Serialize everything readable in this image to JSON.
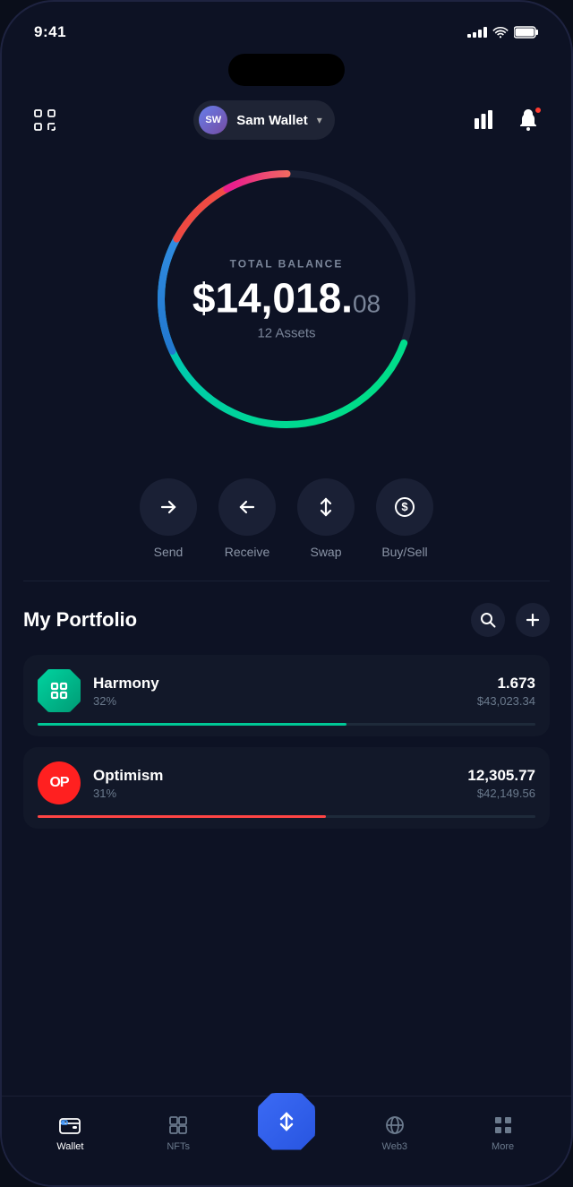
{
  "statusBar": {
    "time": "9:41",
    "signalBars": [
      3,
      5,
      7,
      9,
      11
    ],
    "wifi": true,
    "battery": 100
  },
  "header": {
    "avatarInitials": "SW",
    "walletName": "Sam Wallet",
    "chevron": "▾",
    "scanIconLabel": "scan",
    "chartIconLabel": "chart",
    "notificationIconLabel": "notification"
  },
  "balance": {
    "label": "TOTAL BALANCE",
    "whole": "$14,018.",
    "cents": "08",
    "assets": "12 Assets"
  },
  "actions": [
    {
      "id": "send",
      "label": "Send",
      "icon": "→"
    },
    {
      "id": "receive",
      "label": "Receive",
      "icon": "←"
    },
    {
      "id": "swap",
      "label": "Swap",
      "icon": "⇅"
    },
    {
      "id": "buysell",
      "label": "Buy/Sell",
      "icon": "💲"
    }
  ],
  "portfolio": {
    "title": "My Portfolio",
    "searchLabel": "search",
    "addLabel": "add",
    "assets": [
      {
        "id": "harmony",
        "name": "Harmony",
        "pct": "32%",
        "amount": "1.673",
        "value": "$43,023.34",
        "barWidth": "62",
        "barColor": "#00c896",
        "iconColor1": "#00d4a0",
        "iconColor2": "#009b75",
        "iconType": "harmony",
        "iconText": "⊞"
      },
      {
        "id": "optimism",
        "name": "Optimism",
        "pct": "31%",
        "amount": "12,305.77",
        "value": "$42,149.56",
        "barWidth": "58",
        "barColor": "#ff4444",
        "iconColor": "#ff2020",
        "iconType": "optimism",
        "iconText": "OP"
      }
    ]
  },
  "bottomNav": {
    "items": [
      {
        "id": "wallet",
        "label": "Wallet",
        "icon": "wallet",
        "active": true
      },
      {
        "id": "nfts",
        "label": "NFTs",
        "icon": "nfts",
        "active": false
      },
      {
        "id": "swap-center",
        "label": "",
        "icon": "swap-center",
        "isCenter": true
      },
      {
        "id": "web3",
        "label": "Web3",
        "icon": "web3",
        "active": false
      },
      {
        "id": "more",
        "label": "More",
        "icon": "more",
        "active": false
      }
    ]
  }
}
